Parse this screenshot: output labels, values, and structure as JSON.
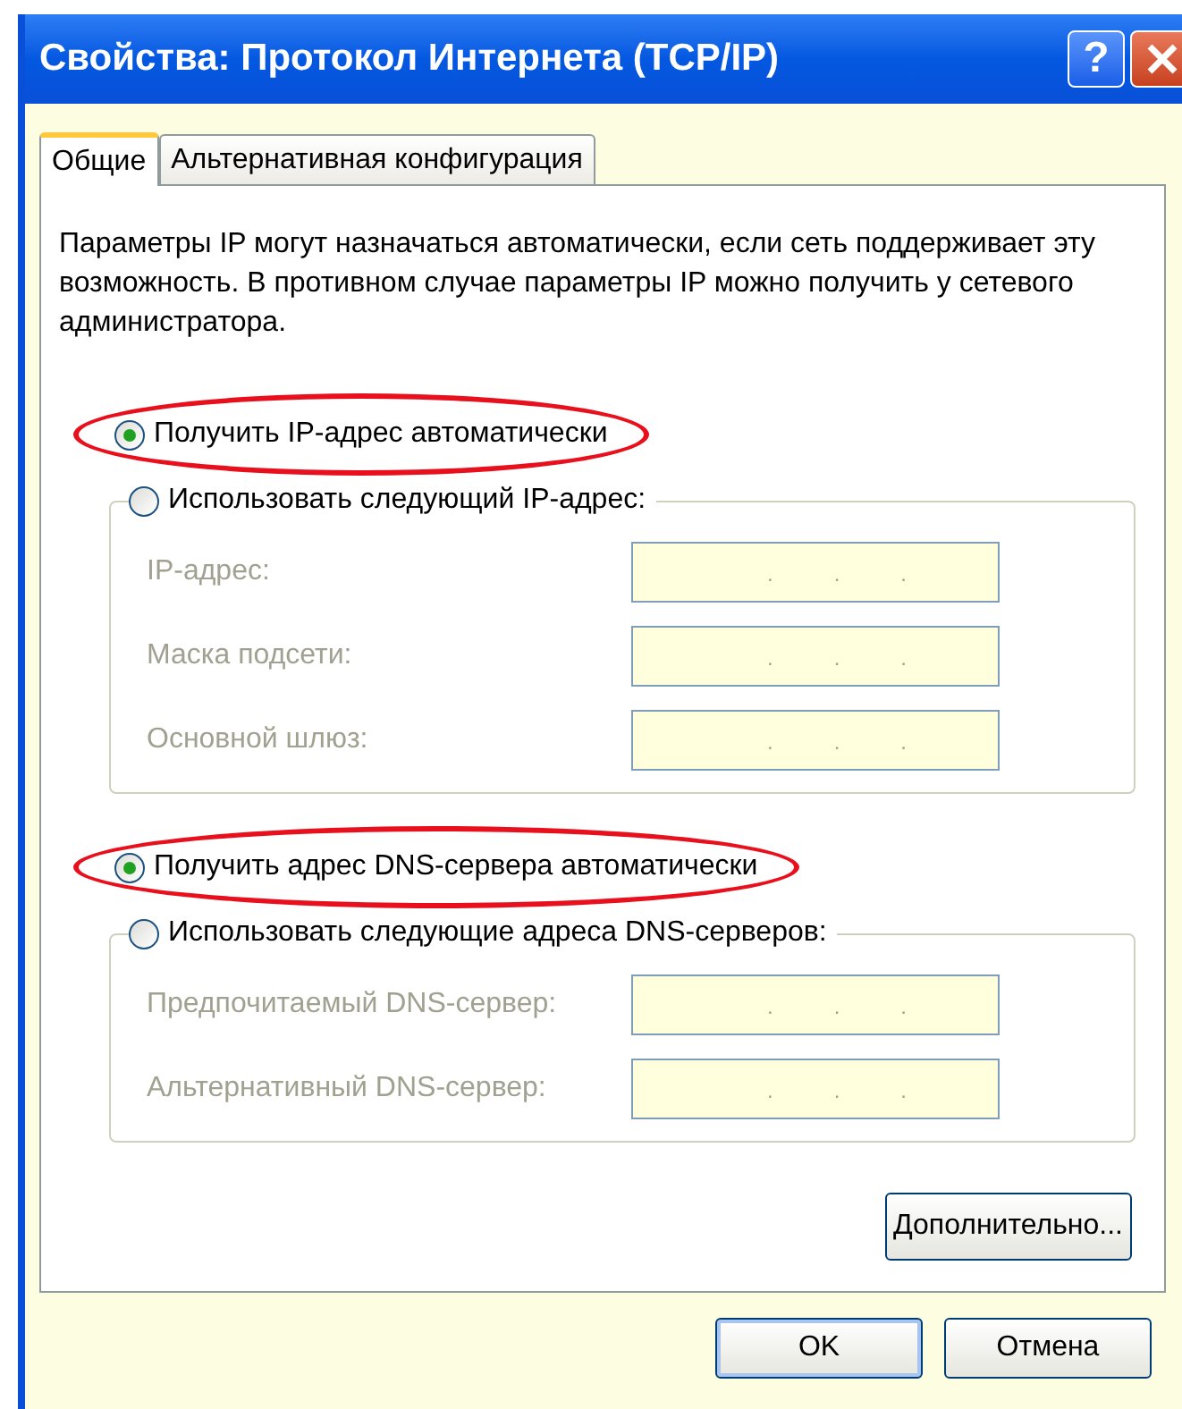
{
  "window": {
    "title": "Свойства: Протокол Интернета (TCP/IP)",
    "title_buttons": [
      {
        "kind": "help",
        "label": "?"
      },
      {
        "kind": "close"
      }
    ]
  },
  "tabs": [
    {
      "label": "Общие",
      "selected": true
    },
    {
      "label": "Альтернативная конфигурация",
      "selected": false
    }
  ],
  "description": "Параметры IP могут назначаться автоматически, если сеть поддерживает эту возможность. В противном случае параметры IP можно получить у сетевого администратора.",
  "sections": [
    {
      "auto_option": {
        "label": "Получить IP-адрес автоматически",
        "selected": true,
        "highlighted": true
      },
      "manual_option": {
        "label": "Использовать следующий IP-адрес:",
        "selected": false
      },
      "fields": [
        {
          "label": "IP-адрес:",
          "disabled": true,
          "separators": [
            ".",
            ".",
            "."
          ]
        },
        {
          "label": "Маска подсети:",
          "disabled": true,
          "separators": [
            ".",
            ".",
            "."
          ]
        },
        {
          "label": "Основной шлюз:",
          "disabled": true,
          "separators": [
            ".",
            ".",
            "."
          ]
        }
      ]
    },
    {
      "auto_option": {
        "label": "Получить адрес DNS-сервера автоматически",
        "selected": true,
        "highlighted": true
      },
      "manual_option": {
        "label": "Использовать следующие адреса DNS-серверов:",
        "selected": false
      },
      "fields": [
        {
          "label": "Предпочитаемый DNS-сервер:",
          "disabled": true,
          "separators": [
            ".",
            ".",
            "."
          ]
        },
        {
          "label": "Альтернативный DNS-сервер:",
          "disabled": true,
          "separators": [
            ".",
            ".",
            "."
          ]
        }
      ]
    }
  ],
  "advanced_button": "Дополнительно...",
  "buttons": [
    "OK",
    "Отмена"
  ]
}
